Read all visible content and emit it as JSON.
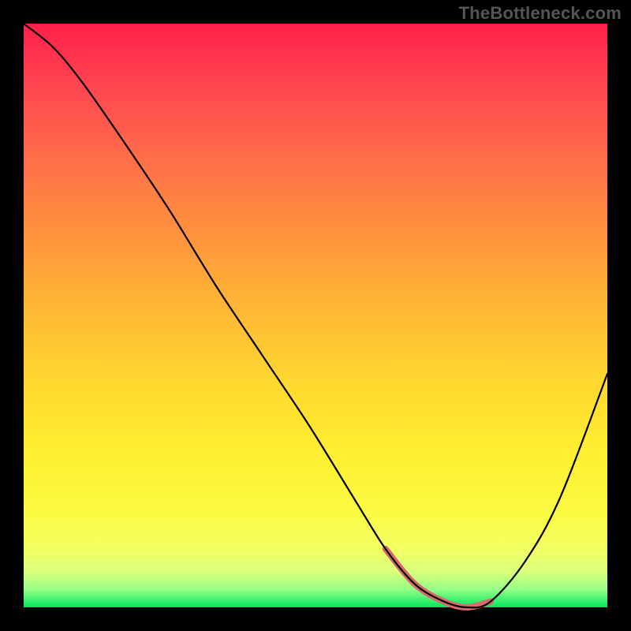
{
  "watermark": "TheBottleneck.com",
  "colors": {
    "background": "#000000",
    "curve": "#000000",
    "highlight": "#d86b6b",
    "text": "#555555"
  },
  "chart_data": {
    "type": "line",
    "title": "",
    "xlabel": "",
    "ylabel": "",
    "xlim": [
      0,
      100
    ],
    "ylim": [
      0,
      100
    ],
    "grid": false,
    "legend": false,
    "series": [
      {
        "name": "curve",
        "x": [
          0,
          5,
          10,
          17,
          25,
          33,
          41,
          49,
          57,
          62,
          67,
          72,
          76,
          80,
          86,
          92,
          100
        ],
        "values": [
          100,
          96,
          90,
          80,
          68,
          55,
          43,
          31,
          18,
          10,
          4,
          1,
          0,
          1,
          8,
          19,
          40
        ]
      }
    ],
    "highlight_range_x": [
      62,
      80
    ],
    "gradient_stops": [
      {
        "pct": 0,
        "color": "#ff1f4a"
      },
      {
        "pct": 9,
        "color": "#ff4050"
      },
      {
        "pct": 22,
        "color": "#ff6a4a"
      },
      {
        "pct": 33,
        "color": "#ff8a3f"
      },
      {
        "pct": 47,
        "color": "#ffb236"
      },
      {
        "pct": 62,
        "color": "#ffd92f"
      },
      {
        "pct": 74,
        "color": "#ffef32"
      },
      {
        "pct": 84,
        "color": "#fbfb43"
      },
      {
        "pct": 90,
        "color": "#f2ff63"
      },
      {
        "pct": 94,
        "color": "#d9ff7d"
      },
      {
        "pct": 97,
        "color": "#93ff86"
      },
      {
        "pct": 100,
        "color": "#00e75d"
      }
    ]
  }
}
